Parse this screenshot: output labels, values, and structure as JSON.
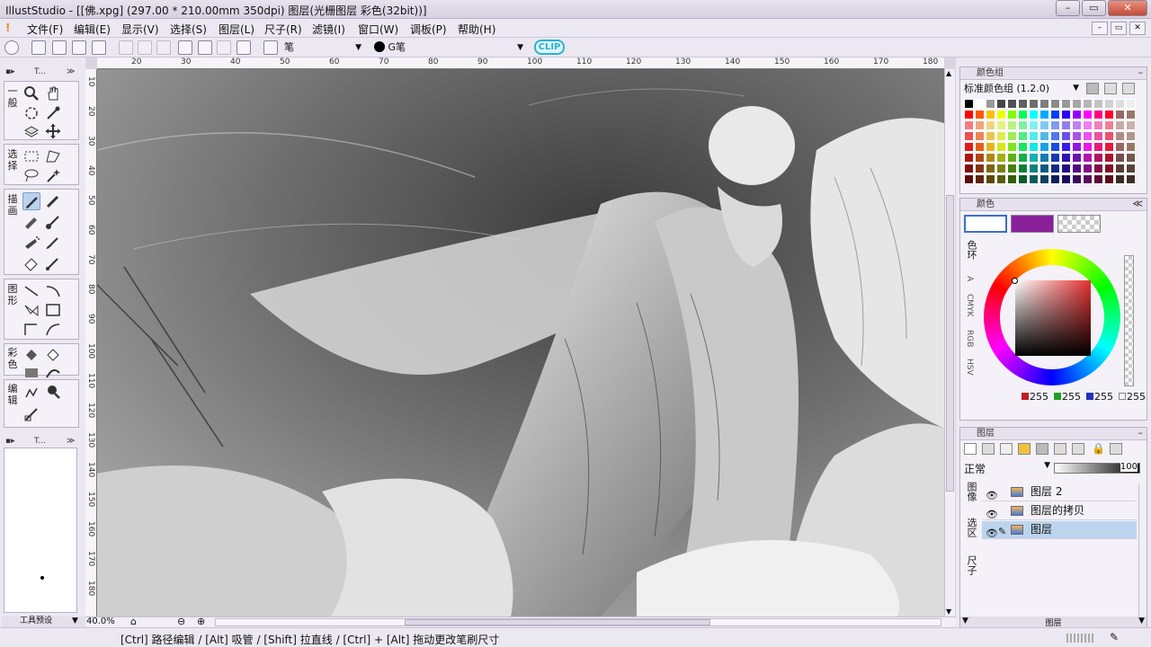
{
  "window": {
    "title": "IllustStudio - [[佛.xpg] (297.00 * 210.00mm 350dpi)  图层(光栅图层 彩色(32bit))]",
    "min_label": "–",
    "max_label": "▭",
    "close_label": "✕"
  },
  "menu": [
    "文件(F)",
    "编辑(E)",
    "显示(V)",
    "选择(S)",
    "图层(L)",
    "尺子(R)",
    "滤镜(I)",
    "窗口(W)",
    "调板(P)",
    "帮助(H)"
  ],
  "toolbar": {
    "brush_name": "笔",
    "brush_preset": "G笔",
    "logo": "CLIP"
  },
  "tool_panel": {
    "title": "T...",
    "groups": [
      "一般",
      "选择",
      "描画",
      "图形",
      "彩色",
      "编辑"
    ],
    "sub_title": "T...",
    "footer_label": "工具预设",
    "zoom": "40.0%"
  },
  "ruler": {
    "top": [
      "20",
      "30",
      "40",
      "50",
      "60",
      "70",
      "80",
      "90",
      "100",
      "110",
      "120",
      "130",
      "140",
      "150",
      "160",
      "170",
      "180"
    ],
    "left": [
      "10",
      "20",
      "30",
      "40",
      "50",
      "60",
      "70",
      "80",
      "90",
      "100",
      "110",
      "120",
      "130",
      "140",
      "150",
      "160",
      "170",
      "180"
    ]
  },
  "colorset": {
    "title": "颜色组",
    "selected": "标准颜色组 (1.2.0)"
  },
  "color": {
    "title": "颜色",
    "tabs": [
      "色环",
      "A",
      "CMYK",
      "RGB",
      "HSV"
    ],
    "r": "255",
    "g": "255",
    "b": "255",
    "a": "255",
    "main": "#ffffff",
    "sub": "#8a1f9a"
  },
  "layers": {
    "title": "图层",
    "blend": "正常",
    "opacity": "100",
    "side_tabs": [
      "图像",
      "选区",
      "尺子"
    ],
    "items": [
      {
        "name": "图层 2"
      },
      {
        "name": "图层的拷贝"
      },
      {
        "name": "图层"
      }
    ],
    "footer": "图层"
  },
  "status": {
    "hint": "[Ctrl] 路径编辑 / [Alt] 吸管 / [Shift] 拉直线 / [Ctrl] + [Alt] 拖动更改笔刷尺寸"
  }
}
